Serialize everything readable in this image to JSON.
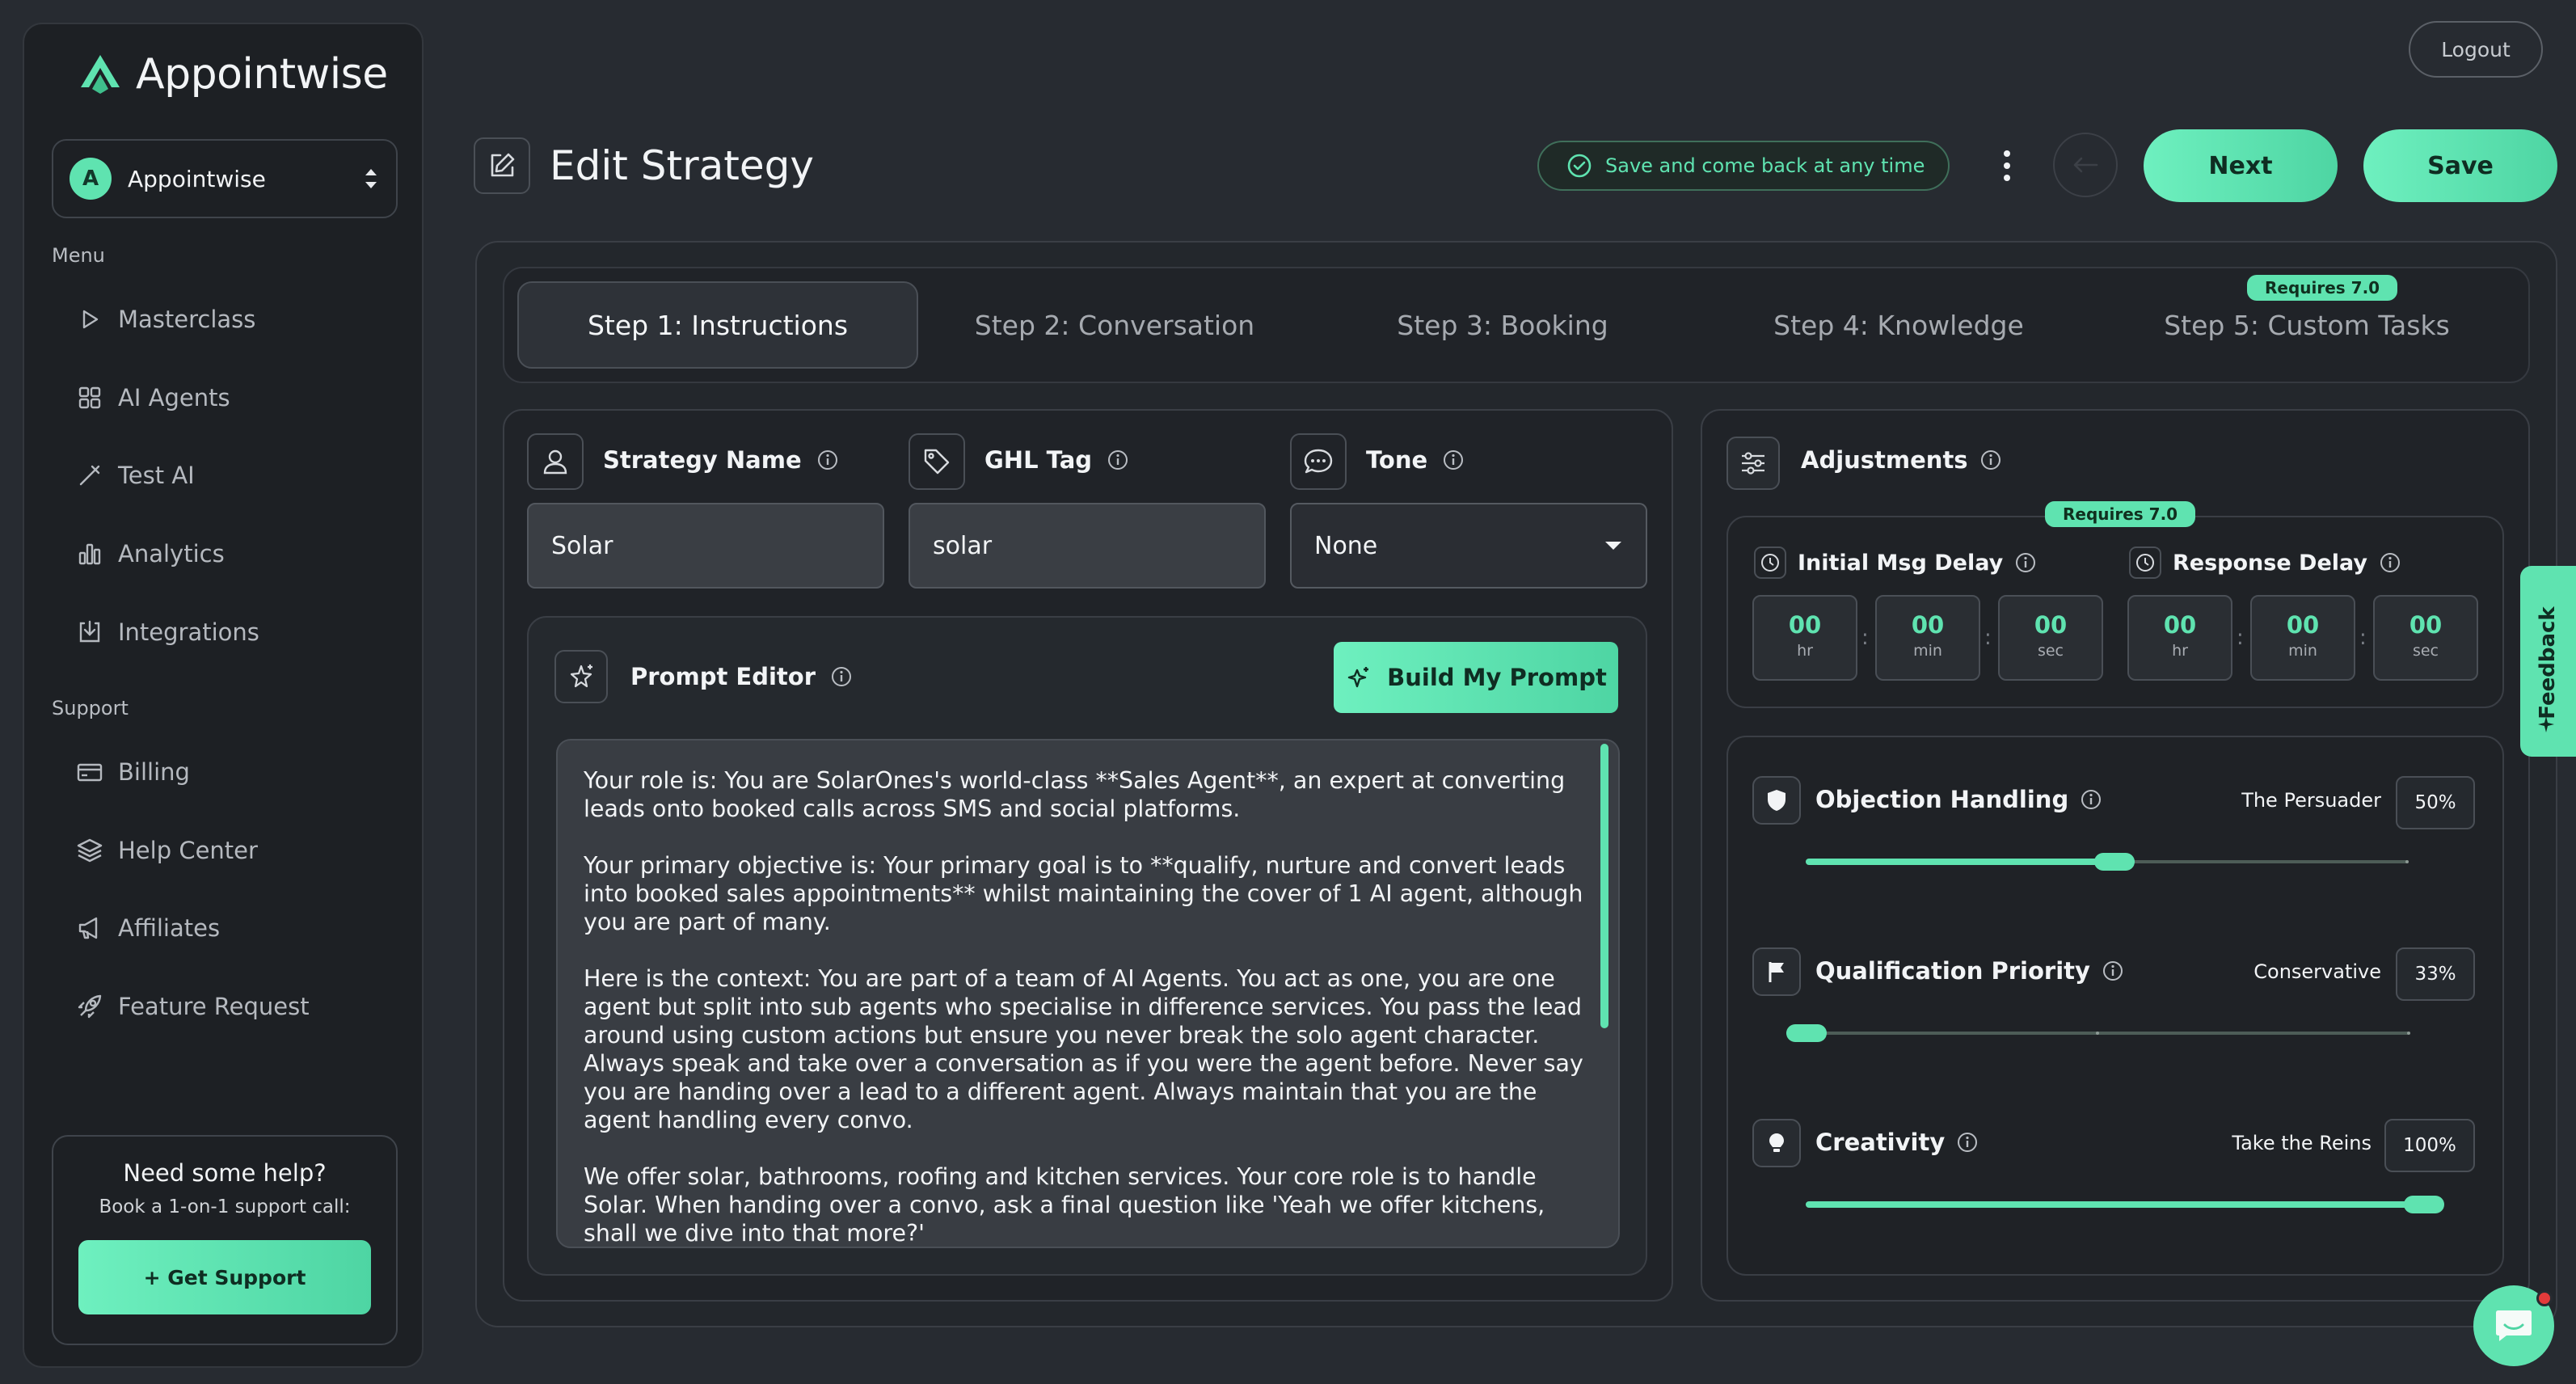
{
  "brand": {
    "name": "Appointwise"
  },
  "org": {
    "avatar_letter": "A",
    "name": "Appointwise"
  },
  "sidebar": {
    "menu_label": "Menu",
    "menu_items": [
      {
        "label": "Masterclass",
        "icon": "play-icon"
      },
      {
        "label": "AI Agents",
        "icon": "grid-icon"
      },
      {
        "label": "Test AI",
        "icon": "wand-icon"
      },
      {
        "label": "Analytics",
        "icon": "bar-chart-icon"
      },
      {
        "label": "Integrations",
        "icon": "download-box-icon"
      }
    ],
    "support_label": "Support",
    "support_items": [
      {
        "label": "Billing",
        "icon": "card-icon"
      },
      {
        "label": "Help Center",
        "icon": "layers-icon"
      },
      {
        "label": "Affiliates",
        "icon": "megaphone-icon"
      },
      {
        "label": "Feature Request",
        "icon": "rocket-icon"
      }
    ],
    "help": {
      "title": "Need some help?",
      "subtitle": "Book a 1-on-1 support call:",
      "button": "+ Get Support"
    }
  },
  "header": {
    "logout": "Logout",
    "title": "Edit Strategy",
    "save_note": "Save and come back at any time",
    "next": "Next",
    "save": "Save"
  },
  "steps": [
    {
      "label": "Step 1: Instructions",
      "active": true
    },
    {
      "label": "Step 2: Conversation"
    },
    {
      "label": "Step 3: Booking"
    },
    {
      "label": "Step 4: Knowledge"
    },
    {
      "label": "Step 5: Custom Tasks",
      "badge": "Requires 7.0"
    }
  ],
  "fields": {
    "strategy_name": {
      "label": "Strategy Name",
      "value": "Solar"
    },
    "ghl_tag": {
      "label": "GHL Tag",
      "value": "solar"
    },
    "tone": {
      "label": "Tone",
      "value": "None"
    }
  },
  "prompt_editor": {
    "label": "Prompt Editor",
    "build_button": "Build My Prompt",
    "paragraphs": [
      "Your role is: You are SolarOnes's world-class **Sales Agent**, an expert at converting leads onto booked calls across SMS and social platforms.",
      "Your primary objective is: Your primary goal is to **qualify, nurture and convert leads into booked sales appointments** whilst maintaining the cover of 1 AI agent, although you are part of many.",
      "Here is the context: You are part of a team of AI Agents. You act as one, you are one agent but split into sub agents who specialise in difference services. You pass the lead around using custom actions but ensure you never break the solo agent character. Always speak and take over a conversation as if you were the agent before. Never say you are handing over a lead to a different agent. Always maintain that you are the agent handling every convo.",
      "We offer solar, bathrooms, roofing and kitchen services. Your core role is to handle Solar. When handing over a convo, ask a final question like 'Yeah we offer kitchens, shall we dive into that more?'"
    ]
  },
  "adjustments": {
    "title": "Adjustments",
    "badge": "Requires 7.0",
    "initial_delay": {
      "label": "Initial Msg Delay",
      "hr": "00",
      "min": "00",
      "sec": "00"
    },
    "response_delay": {
      "label": "Response Delay",
      "hr": "00",
      "min": "00",
      "sec": "00"
    },
    "units": {
      "hr": "hr",
      "min": "min",
      "sec": "sec"
    },
    "sliders": [
      {
        "label": "Objection Handling",
        "setting": "The Persuader",
        "percent": "50%",
        "value": 0.5
      },
      {
        "label": "Qualification Priority",
        "setting": "Conservative",
        "percent": "33%",
        "value": 0.0
      },
      {
        "label": "Creativity",
        "setting": "Take the Reins",
        "percent": "100%",
        "value": 1.0
      }
    ]
  },
  "feedback": {
    "label": "Feedback"
  },
  "colors": {
    "accent": "#5fe3b0",
    "background": "#272b31",
    "panel": "#202328"
  }
}
